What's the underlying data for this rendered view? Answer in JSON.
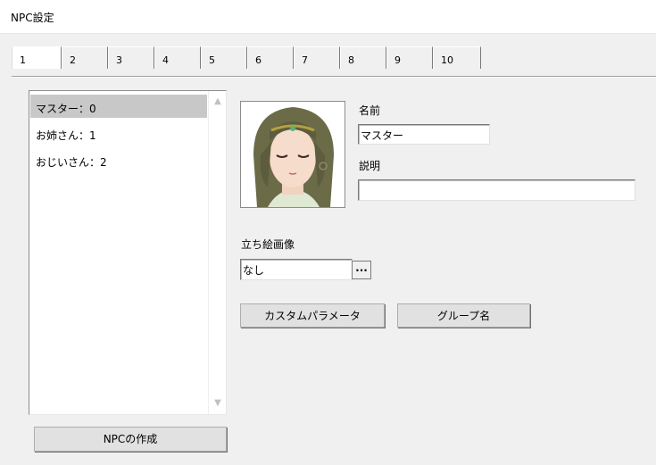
{
  "window": {
    "title": "NPC設定"
  },
  "tabs": [
    "1",
    "2",
    "3",
    "4",
    "5",
    "6",
    "7",
    "8",
    "9",
    "10"
  ],
  "npc_list": {
    "items": [
      "マスター：0",
      "お姉さん：1",
      "おじいさん：2"
    ],
    "selected_index": 0
  },
  "create_button": "NPCの作成",
  "form": {
    "name_label": "名前",
    "name_value": "マスター",
    "desc_label": "説明",
    "desc_value": "",
    "standing_label": "立ち絵画像",
    "standing_value": "なし",
    "browse_label": "...",
    "custom_param_button": "カスタムパラメータ",
    "group_name_button": "グループ名"
  },
  "colors": {
    "selected_row": "#c8c8c8",
    "window_bg": "#f0f0f0"
  }
}
